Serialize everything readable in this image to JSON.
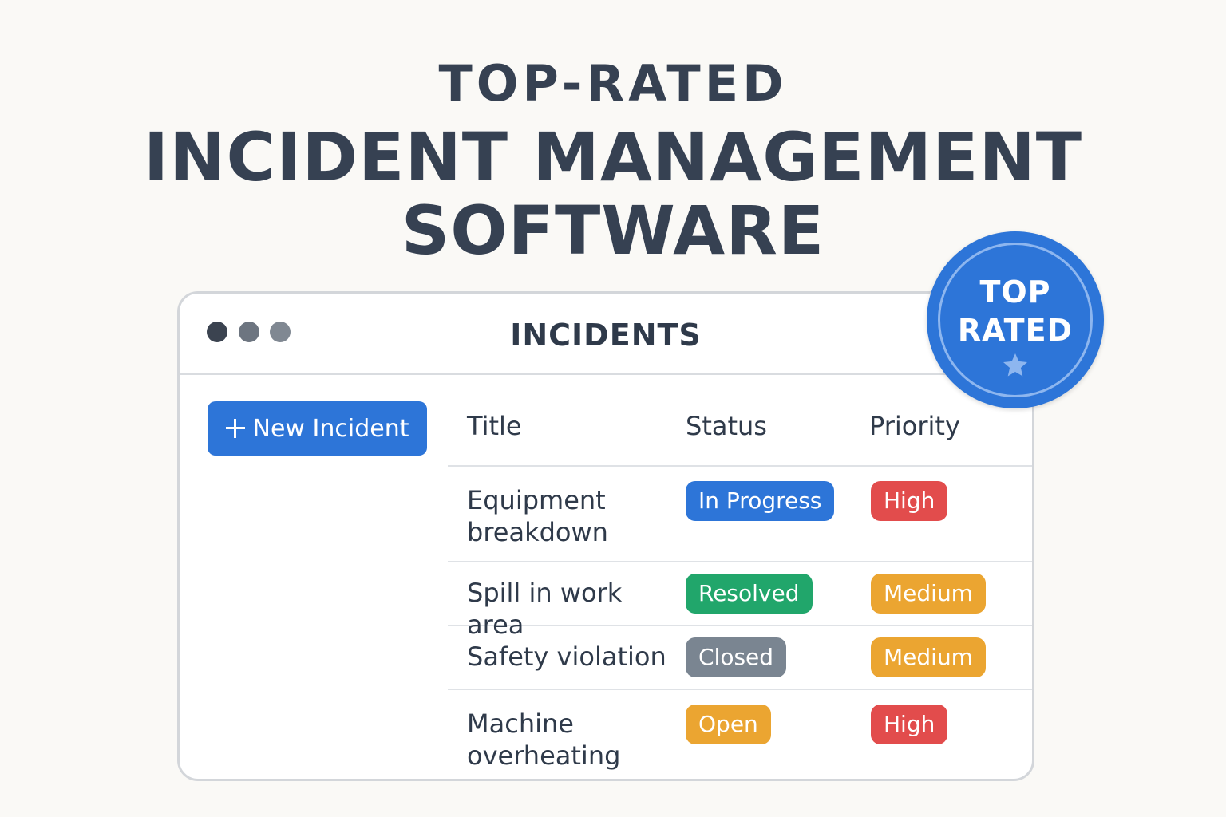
{
  "headline": {
    "kicker": "TOP-RATED",
    "line1": "INCIDENT MANAGEMENT",
    "line2": "SOFTWARE"
  },
  "window": {
    "title": "INCIDENTS",
    "traffic_dots": [
      "#3b4350",
      "#6d7580",
      "#808892"
    ]
  },
  "toolbar": {
    "new_incident_label": "New Incident",
    "icon": "plus-icon"
  },
  "table": {
    "headers": [
      "Title",
      "Status",
      "Priority"
    ],
    "rows": [
      {
        "title": "Equipment breakdown",
        "status": "In Progress",
        "priority": "High"
      },
      {
        "title": "Spill in work area",
        "status": "Resolved",
        "priority": "Medium"
      },
      {
        "title": "Safety violation",
        "status": "Closed",
        "priority": "Medium"
      },
      {
        "title": "Machine overheating",
        "status": "Open",
        "priority": "High"
      }
    ]
  },
  "status_colors": {
    "In Progress": "#2d75d8",
    "Resolved": "#21a66b",
    "Closed": "#7a8591",
    "Open": "#eba531"
  },
  "priority_colors": {
    "High": "#e24c4c",
    "Medium": "#eba531"
  },
  "seal": {
    "line1": "TOP",
    "line2": "RATED",
    "icon": "star-icon",
    "color": "#2d75d8"
  }
}
